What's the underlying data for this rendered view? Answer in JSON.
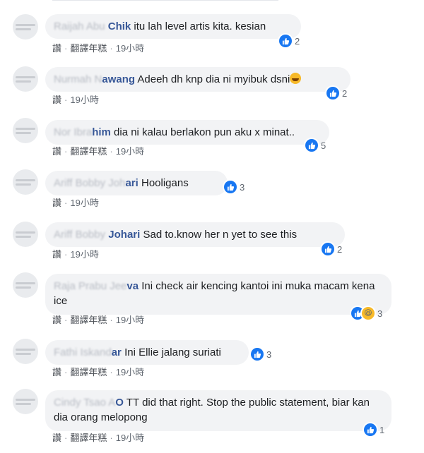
{
  "comments": [
    {
      "name_blur": "Raijah Abu",
      "name": "Chik",
      "text": "itu lah level artis kita. kesian",
      "actions": [
        "讚",
        "翻譯年糕",
        "19小時"
      ],
      "reactions": {
        "count": "2",
        "types": [
          "like"
        ]
      }
    },
    {
      "name_blur": "Nurmah N",
      "name": "awang",
      "text": "Adeeh dh knp dia ni myibuk dsni",
      "actions": [
        "讚",
        "19小時"
      ],
      "reactions": {
        "count": "2",
        "types": [
          "like"
        ]
      }
    },
    {
      "name_blur": "Nor Ibra",
      "name": "him",
      "text": "dia ni kalau berlakon pun aku x minat..",
      "actions": [
        "讚",
        "翻譯年糕",
        "19小時"
      ],
      "reactions": {
        "count": "5",
        "types": [
          "like"
        ]
      }
    },
    {
      "name_blur": "Ariff Bobby Joh",
      "name": "ari",
      "text": "Hooligans",
      "actions": [
        "讚",
        "19小時"
      ],
      "reactions": {
        "count": "3",
        "types": [
          "like"
        ]
      }
    },
    {
      "name_blur": "Ariff Bobby",
      "name": "Johari",
      "text": "Sad to.know her n yet to see this",
      "actions": [
        "讚",
        "19小時"
      ],
      "reactions": {
        "count": "2",
        "types": [
          "like"
        ]
      }
    },
    {
      "name_blur": "Raja Prabu Jee",
      "name": "va",
      "text": "Ini check air kencing kantoi ini muka macam kena ice",
      "actions": [
        "讚",
        "翻譯年糕",
        "19小時"
      ],
      "reactions": {
        "count": "3",
        "types": [
          "like",
          "haha"
        ]
      }
    },
    {
      "name_blur": "Fathi Iskand",
      "name": "ar",
      "text": "Ini Ellie jalang suriati",
      "actions": [
        "讚",
        "翻譯年糕",
        "19小時"
      ],
      "reactions": {
        "count": "3",
        "types": [
          "like"
        ]
      }
    },
    {
      "name_blur": "Cindy Tsao A",
      "name": "O",
      "text": "TT did that right. Stop the public statement, biar kan dia orang melopong",
      "actions": [
        "讚",
        "翻譯年糕",
        "19小時"
      ],
      "reactions": {
        "count": "1",
        "types": [
          "like"
        ]
      }
    }
  ]
}
